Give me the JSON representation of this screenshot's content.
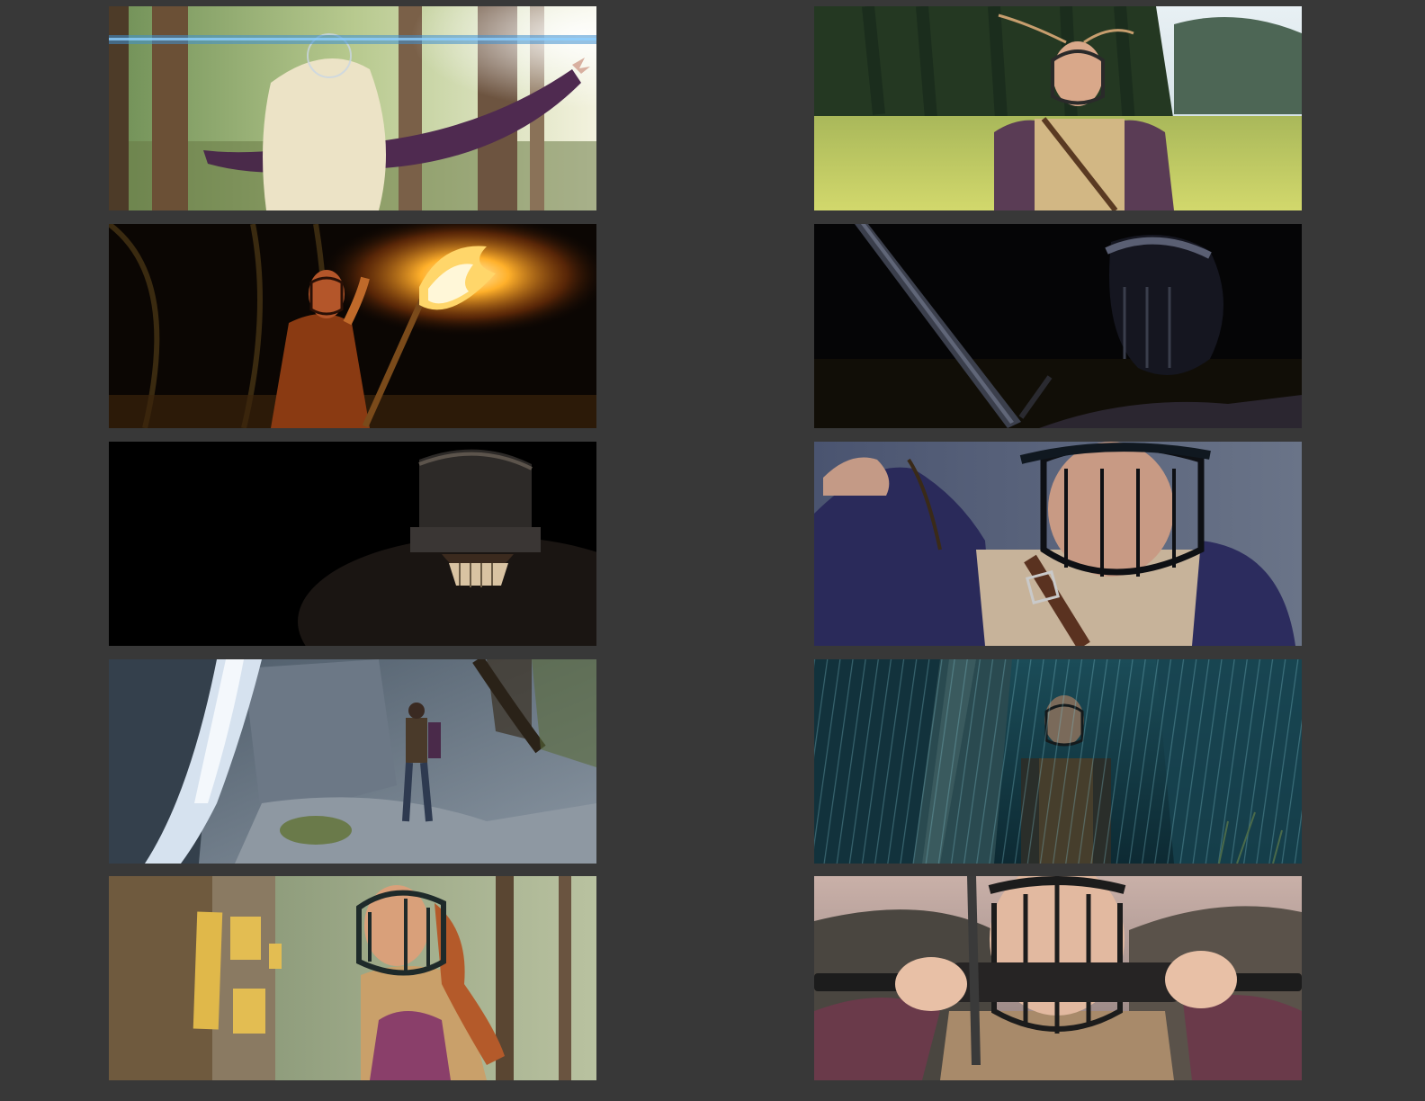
{
  "page": {
    "background_color": "#383838"
  },
  "frames": [
    {
      "id": 1,
      "scene": "sunlit-forest-veiled-figure",
      "palette": [
        "#8fae6a",
        "#e9e2c7",
        "#5a3a5e",
        "#3f8fd0"
      ]
    },
    {
      "id": 2,
      "scene": "meadow-masked-woman",
      "palette": [
        "#2f4a2a",
        "#c6d06a",
        "#6a4a5a",
        "#d9c18a"
      ]
    },
    {
      "id": 3,
      "scene": "night-torch-bearer",
      "palette": [
        "#0b0603",
        "#ff9a1f",
        "#8a3a10",
        "#3a2a0a"
      ]
    },
    {
      "id": 4,
      "scene": "dark-sword-profile",
      "palette": [
        "#050506",
        "#1a1c24",
        "#5a5f73",
        "#2b2630"
      ]
    },
    {
      "id": 5,
      "scene": "black-helm-skull",
      "palette": [
        "#000000",
        "#2a2522",
        "#5c544c",
        "#b39a7c"
      ]
    },
    {
      "id": 6,
      "scene": "blue-hour-closeup",
      "palette": [
        "#3a4660",
        "#2a2a58",
        "#c7b39a",
        "#111118"
      ]
    },
    {
      "id": 7,
      "scene": "waterfall-rocky-trail",
      "palette": [
        "#5a6a7a",
        "#c9d6e4",
        "#34404c",
        "#6a7a4a"
      ]
    },
    {
      "id": 8,
      "scene": "teal-rain-forest",
      "palette": [
        "#0d2a33",
        "#1f5563",
        "#5fa0ab",
        "#3a3a2a"
      ]
    },
    {
      "id": 9,
      "scene": "forest-tree-notes-profile",
      "palette": [
        "#6f5a3e",
        "#e0b84a",
        "#8a3f6a",
        "#b9c2a0"
      ]
    },
    {
      "id": 10,
      "scene": "sword-held-before-face",
      "palette": [
        "#3a3440",
        "#e2b9a0",
        "#1c1c1c",
        "#6a3a4a"
      ]
    }
  ]
}
